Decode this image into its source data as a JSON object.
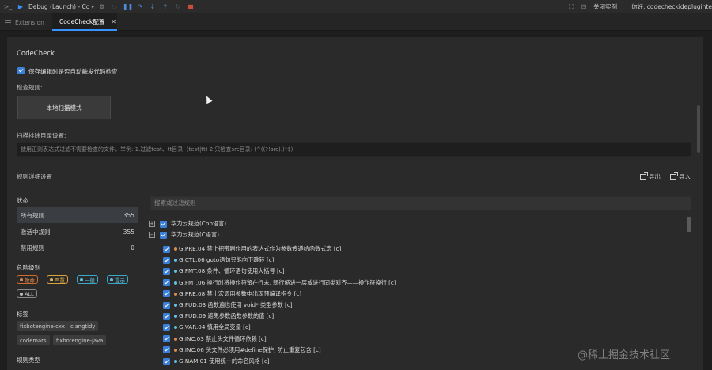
{
  "toolbar": {
    "debug_config": "Debug (Launch) - Co",
    "close_instance": "关闭实例",
    "welcome": "你好, codecheckidepluginte"
  },
  "tabs": [
    {
      "label": "Extension",
      "active": false
    },
    {
      "label": "CodeCheck配置",
      "active": true
    }
  ],
  "panel": {
    "title": "CodeCheck",
    "autocheck_label": "保存编辑时是否自动触发代码检查",
    "autocheck_checked": true,
    "rules_label": "检查规则:",
    "scan_mode_button": "本地扫描模式",
    "exclude_label": "扫描排除目录设置:",
    "exclude_placeholder": "使用正则表达式过滤不需要检查的文件。举例: 1.过滤test、tt目录: (test|tt) 2.只检查src目录: (^((?!src).)*$)",
    "detail_label": "规则详细设置",
    "export_label": "导出",
    "import_label": "导入"
  },
  "status": {
    "heading": "状态",
    "rows": [
      {
        "label": "所有规则",
        "count": "355",
        "active": true
      },
      {
        "label": "激活中规则",
        "count": "355",
        "active": false
      },
      {
        "label": "禁用规则",
        "count": "0",
        "active": false
      }
    ]
  },
  "danger": {
    "heading": "危险级别",
    "levels": [
      "致命",
      "严重",
      "一般",
      "提示",
      "ALL"
    ]
  },
  "tags": {
    "heading": "标签",
    "items": [
      "fixbotengine-cxx",
      "clangtidy",
      "codemars",
      "fixbotengine-java"
    ]
  },
  "rule_type_heading": "规则类型",
  "search_placeholder": "搜索或过滤规则",
  "tree": {
    "groups": [
      {
        "label": "华为云规范(Cpp语言)",
        "expander": "+"
      },
      {
        "label": "华为云规范(C语言)",
        "expander": "−"
      }
    ],
    "rules": [
      {
        "severity": "orange",
        "label": "G.PRE.04 禁止把带副作用的表达式作为参数传递给函数式宏 [c]"
      },
      {
        "severity": "blue",
        "label": "G.CTL.06 goto语句只能向下跳转 [c]"
      },
      {
        "severity": "blue",
        "label": "G.FMT.08 条件、循环语句使用大括号 [c]"
      },
      {
        "severity": "blue",
        "label": "G.FMT.06 换行时将操作符留在行末, 新行缩进一层或进行同类对齐——操作符换行 [c]"
      },
      {
        "severity": "orange",
        "label": "G.PRE.08 禁止宏调用参数中出现预编译指令 [c]"
      },
      {
        "severity": "blue",
        "label": "G.FUD.03 函数遍也使用 void* 类型参数 [c]"
      },
      {
        "severity": "blue",
        "label": "G.FUD.09 避免参数函数参数的值 [c]"
      },
      {
        "severity": "blue",
        "label": "G.VAR.04 慎用全局变量 [c]"
      },
      {
        "severity": "orange",
        "label": "G.INC.03 禁止头文件循环依赖 [c]"
      },
      {
        "severity": "orange",
        "label": "G.INC.06 头文件必须用#define保护, 防止重复包含 [c]"
      },
      {
        "severity": "blue",
        "label": "G.NAM.01 使用统一的命名风格 [c]"
      }
    ]
  },
  "watermark": "@稀土掘金技术社区"
}
